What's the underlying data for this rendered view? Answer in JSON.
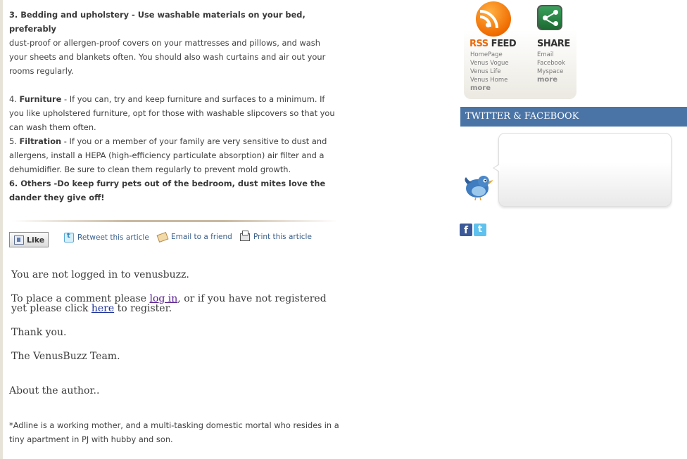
{
  "article": {
    "item3_title": "3. Bedding and upholstery - Use washable materials on your bed, preferably",
    "item3_body": "dust-proof or allergen-proof covers on your mattresses and pillows, and wash your sheets and blankets often. You should also wash curtains and air out your rooms regularly.",
    "item4_number": "4. ",
    "item4_title": "Furniture",
    "item4_body": " - If you can, try and keep furniture and surfaces to a minimum. If you like upholstered furniture, opt for those with washable slipcovers so that you can wash them often.",
    "item5_number": "5. ",
    "item5_title": "Filtration",
    "item5_body": " - If you or a member of your family are very sensitive to dust and allergens, install a HEPA (high-efficiency particulate absorption) air filter and a dehumidifier. Be sure to clean them regularly to prevent mold growth.",
    "item6": "6. Others -Do keep furry pets out of the bedroom, dust mites love the dander they give off!"
  },
  "share_bar": {
    "like": "Like",
    "retweet": "Retweet this article",
    "email": "Email to a friend",
    "print": "Print this article"
  },
  "comment": {
    "not_logged": "You are not logged in to venusbuzz.",
    "place_pre": "To place a comment please ",
    "login_link": "log in",
    "place_mid": ", or if you have not registered yet please click ",
    "here_link": "here",
    "place_post": " to register.",
    "thanks": "Thank you.",
    "team": "The VenusBuzz Team."
  },
  "about": {
    "heading": "About the author..",
    "bio": "*Adline is a working mother, and a multi-tasking domestic mortal who resides in a tiny apartment in PJ with hubby and son."
  },
  "sidebar": {
    "rss": {
      "title_a": "RSS",
      "title_b": " FEED",
      "links": [
        "HomePage",
        "Venus Vogue",
        "Venus Life",
        "Venus Home"
      ],
      "more": "more"
    },
    "share": {
      "title": "SHARE",
      "links": [
        "Email",
        "Facebook",
        "Myspace"
      ],
      "more": "more"
    },
    "twitter_facebook_header": "TWITTER & FACEBOOK",
    "facebook_icon": "f",
    "twitter_icon": "t"
  },
  "colors": {
    "header_blue": "#4b74a6",
    "rss_orange": "#e96b0e",
    "share_green": "#2e8b4a",
    "link_blue": "#3a5f8a"
  }
}
